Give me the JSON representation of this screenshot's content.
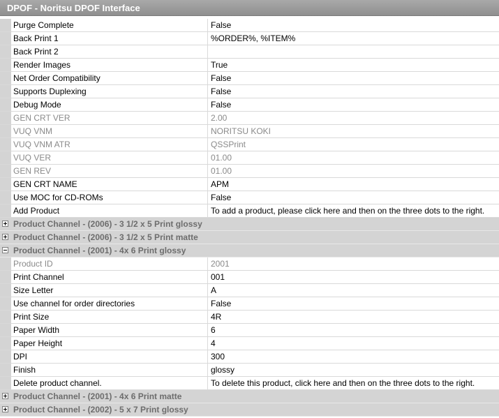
{
  "title": "DPOF - Noritsu DPOF Interface",
  "rows": [
    {
      "type": "prop",
      "name": "Purge Complete",
      "value": "False",
      "readonly": false
    },
    {
      "type": "prop",
      "name": "Back Print 1",
      "value": "%ORDER%, %ITEM%",
      "readonly": false
    },
    {
      "type": "prop",
      "name": "Back Print 2",
      "value": "",
      "readonly": false
    },
    {
      "type": "prop",
      "name": "Render Images",
      "value": "True",
      "readonly": false
    },
    {
      "type": "prop",
      "name": "Net Order Compatibility",
      "value": "False",
      "readonly": false
    },
    {
      "type": "prop",
      "name": "Supports Duplexing",
      "value": "False",
      "readonly": false
    },
    {
      "type": "prop",
      "name": "Debug Mode",
      "value": "False",
      "readonly": false
    },
    {
      "type": "prop",
      "name": "GEN CRT VER",
      "value": "2.00",
      "readonly": true
    },
    {
      "type": "prop",
      "name": "VUQ VNM",
      "value": "NORITSU KOKI",
      "readonly": true
    },
    {
      "type": "prop",
      "name": "VUQ VNM ATR",
      "value": "QSSPrint",
      "readonly": true
    },
    {
      "type": "prop",
      "name": "VUQ VER",
      "value": "01.00",
      "readonly": true
    },
    {
      "type": "prop",
      "name": "GEN REV",
      "value": "01.00",
      "readonly": true
    },
    {
      "type": "prop",
      "name": "GEN CRT NAME",
      "value": "APM",
      "readonly": false
    },
    {
      "type": "prop",
      "name": "Use MOC for CD-ROMs",
      "value": "False",
      "readonly": false
    },
    {
      "type": "prop",
      "name": "Add Product",
      "value": "To add a product, please click here and then on the three dots to the right.",
      "readonly": false
    },
    {
      "type": "category",
      "label": "Product Channel - (2006) - 3 1/2 x 5 Print glossy",
      "expanded": false
    },
    {
      "type": "category",
      "label": "Product Channel - (2006) - 3 1/2 x 5 Print matte",
      "expanded": false
    },
    {
      "type": "category",
      "label": "Product Channel - (2001) - 4x 6 Print glossy",
      "expanded": true
    },
    {
      "type": "prop",
      "name": "Product ID",
      "value": "2001",
      "readonly": true
    },
    {
      "type": "prop",
      "name": "Print Channel",
      "value": "001",
      "readonly": false
    },
    {
      "type": "prop",
      "name": "Size Letter",
      "value": "A",
      "readonly": false
    },
    {
      "type": "prop",
      "name": "Use channel for order directories",
      "value": "False",
      "readonly": false
    },
    {
      "type": "prop",
      "name": "Print Size",
      "value": "4R",
      "readonly": false
    },
    {
      "type": "prop",
      "name": "Paper Width",
      "value": "6",
      "readonly": false
    },
    {
      "type": "prop",
      "name": "Paper Height",
      "value": "4",
      "readonly": false
    },
    {
      "type": "prop",
      "name": "DPI",
      "value": "300",
      "readonly": false
    },
    {
      "type": "prop",
      "name": "Finish",
      "value": "glossy",
      "readonly": false
    },
    {
      "type": "prop",
      "name": "Delete product channel.",
      "value": "To delete this product, click here and then on the three dots to the right.",
      "readonly": false
    },
    {
      "type": "category",
      "label": "Product Channel - (2001) - 4x 6 Print matte",
      "expanded": false
    },
    {
      "type": "category",
      "label": "Product Channel - (2002) - 5 x 7 Print glossy",
      "expanded": false
    }
  ],
  "colors": {
    "title_bar": "#999999",
    "category_bg": "#d4d4d4",
    "readonly_text": "#8a8a8a"
  },
  "icons": {
    "collapsed": "plus-box-icon",
    "expanded": "minus-box-icon"
  }
}
